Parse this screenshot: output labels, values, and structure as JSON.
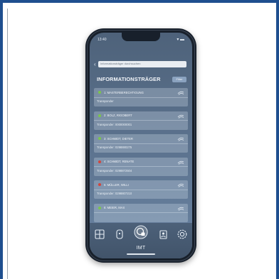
{
  "status": {
    "time": "13:40",
    "icons": "▾ ▬"
  },
  "search": {
    "placeholder": "Informationsträger durchsuchen"
  },
  "header": {
    "title": "INFORMATIONSTRÄGER",
    "filter_label": "Filter"
  },
  "items": [
    {
      "name": "1: MASTERBERECHTIGUNG",
      "sub": "Transponder",
      "status_color": "#7bc54a"
    },
    {
      "name": "2: BOLZ, RIGOBERT",
      "sub": "Transponder: 0000000001",
      "status_color": "#7bc54a"
    },
    {
      "name": "3: SCHMIDT, DIETER",
      "sub": "Transponder: 0298880275",
      "status_color": "#7bc54a"
    },
    {
      "name": "4: SCHMIDT, RENATE",
      "sub": "Transponder: 0298872504",
      "status_color": "#d2453c"
    },
    {
      "name": "5: MÜLLER, WILLI",
      "sub": "Transponder: 0298807210",
      "status_color": "#d2453c"
    },
    {
      "name": "6: MEIER, MAX",
      "sub": "",
      "status_color": "#7bc54a"
    }
  ],
  "tabbar": {
    "app_label": "IMT",
    "tabs": [
      "grid-icon",
      "door-icon",
      "transponder-icon",
      "users-icon",
      "settings-icon"
    ]
  },
  "colors": {
    "frame": "#1f4f8f",
    "ok": "#7bc54a",
    "blocked": "#d2453c"
  }
}
